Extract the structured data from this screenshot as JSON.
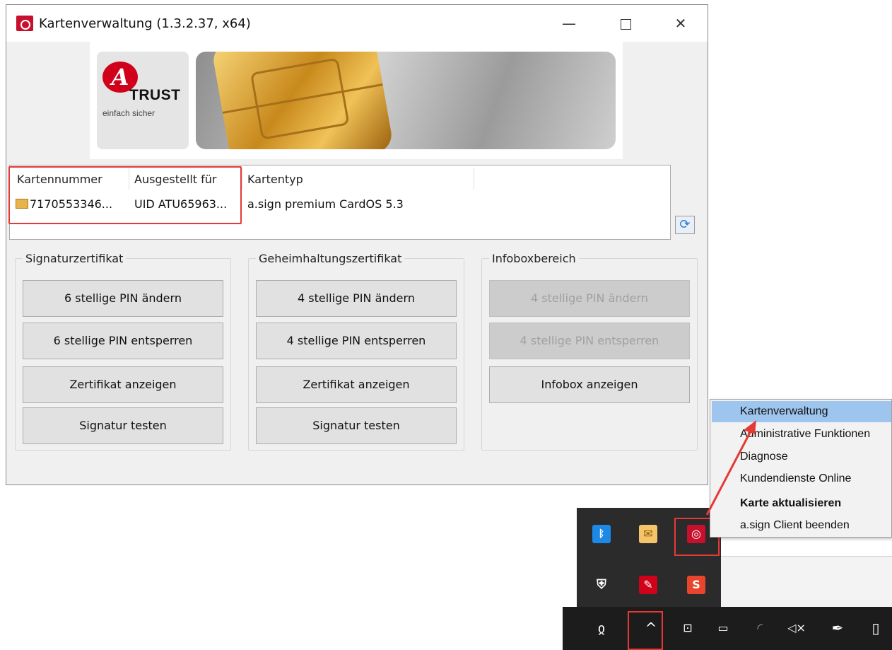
{
  "window": {
    "title": "Kartenverwaltung (1.3.2.37, x64)",
    "minimize_glyph": "—",
    "close_glyph": "✕"
  },
  "banner": {
    "logo_letter": "A",
    "logo_text": "TRUST",
    "logo_tagline": "einfach sicher"
  },
  "card_list": {
    "columns": [
      "Kartennummer",
      "Ausgestellt für",
      "Kartentyp"
    ],
    "rows": [
      {
        "number": "7170553346...",
        "issued_to": "UID ATU65963...",
        "type": "a.sign premium CardOS 5.3"
      }
    ]
  },
  "groups": [
    {
      "title": "Signaturzertifikat",
      "buttons": [
        "6 stellige PIN ändern",
        "6 stellige PIN entsperren",
        "Zertifikat anzeigen",
        "Signatur testen"
      ]
    },
    {
      "title": "Geheimhaltungszertifikat",
      "buttons": [
        "4 stellige PIN ändern",
        "4 stellige PIN entsperren",
        "Zertifikat anzeigen",
        "Signatur testen"
      ]
    },
    {
      "title": "Infoboxbereich",
      "buttons": [
        "4 stellige PIN ändern",
        "4 stellige PIN entsperren",
        "Infobox anzeigen"
      ],
      "disabled": [
        true,
        true,
        false
      ]
    }
  ],
  "context_menu": {
    "items": [
      "Kartenverwaltung",
      "Administrative Funktionen",
      "Diagnose",
      "Kundendienste Online",
      "Karte aktualisieren",
      "a.sign Client beenden"
    ],
    "active_index": 0,
    "bold_index": 4
  },
  "tray": {
    "icons": [
      "bluetooth-icon",
      "mail-icon",
      "asign-icon",
      "security-icon",
      "acrobat-icon",
      "s-app-icon"
    ],
    "s_label": "S"
  },
  "colors": {
    "highlight_red": "#e53935",
    "menu_active": "#9ec5ee",
    "brand_red": "#c8102e"
  }
}
